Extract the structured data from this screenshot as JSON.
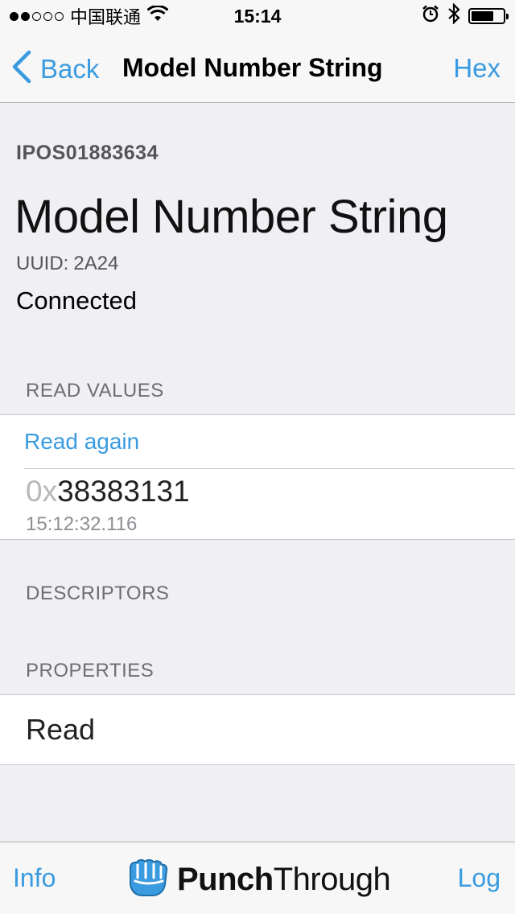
{
  "status_bar": {
    "carrier": "中国联通",
    "time": "15:14",
    "signal_bars_filled": 2,
    "signal_bars_total": 5,
    "icons": [
      "wifi-icon",
      "alarm-icon",
      "bluetooth-icon",
      "battery-icon"
    ]
  },
  "nav": {
    "back_label": "Back",
    "title": "Model Number String",
    "right_label": "Hex"
  },
  "header": {
    "device_id": "IPOS01883634",
    "characteristic_name": "Model Number String",
    "uuid_prefix": "UUID:",
    "uuid": "2A24",
    "connection_status": "Connected"
  },
  "read_values": {
    "section_title": "READ VALUES",
    "read_again_label": "Read again",
    "values": [
      {
        "prefix": "0x",
        "hex": "38383131",
        "timestamp": "15:12:32.116"
      }
    ]
  },
  "descriptors": {
    "section_title": "DESCRIPTORS"
  },
  "properties": {
    "section_title": "PROPERTIES",
    "items": [
      "Read"
    ]
  },
  "tab_bar": {
    "left_label": "Info",
    "right_label": "Log",
    "logo_bold": "Punch",
    "logo_regular": "Through"
  },
  "colors": {
    "accent": "#3a9be0",
    "background": "#efeff4",
    "section_header": "#6d6d72"
  }
}
